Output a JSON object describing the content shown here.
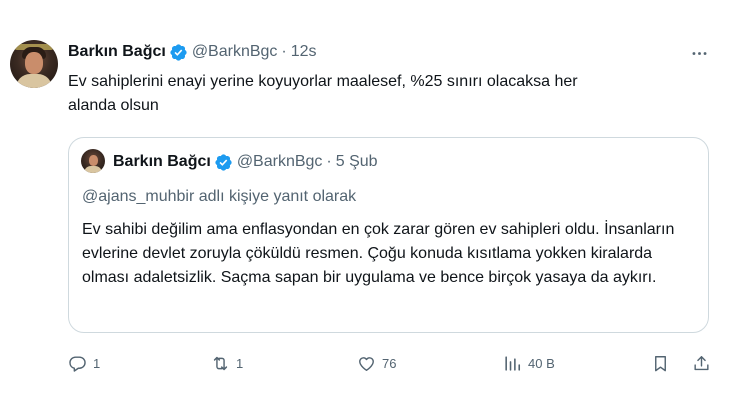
{
  "tweet": {
    "author_name": "Barkın Bağcı",
    "author_handle": "@BarknBgc",
    "separator": "·",
    "time": "12s",
    "text": "Ev sahiplerini enayi yerine koyuyorlar maalesef, %25 sınırı olacaksa her alanda olsun"
  },
  "quote": {
    "author_name": "Barkın Bağcı",
    "author_handle": "@BarknBgc",
    "separator": "·",
    "time": "5 Şub",
    "reply_mention": "@ajans_muhbir",
    "reply_suffix": " adlı kişiye yanıt olarak",
    "text": "Ev sahibi değilim ama enflasyondan en çok zarar gören ev sahipleri oldu. İnsanların evlerine devlet zoruyla çöküldü resmen. Çoğu konuda kısıtlama yokken kiralarda olması adaletsizlik. Saçma sapan bir uygulama ve bence birçok yasaya da aykırı."
  },
  "actions": {
    "reply_count": "1",
    "retweet_count": "1",
    "like_count": "76",
    "views_count": "40 B"
  },
  "icons": {
    "verified": "verified-badge-icon",
    "more": "more-icon",
    "reply": "reply-icon",
    "retweet": "retweet-icon",
    "like": "heart-icon",
    "views": "views-icon",
    "bookmark": "bookmark-icon",
    "share": "share-icon"
  },
  "colors": {
    "verified_blue": "#1d9bf0",
    "text_primary": "#0f1419",
    "text_secondary": "#536471",
    "border": "#cfd9de"
  }
}
